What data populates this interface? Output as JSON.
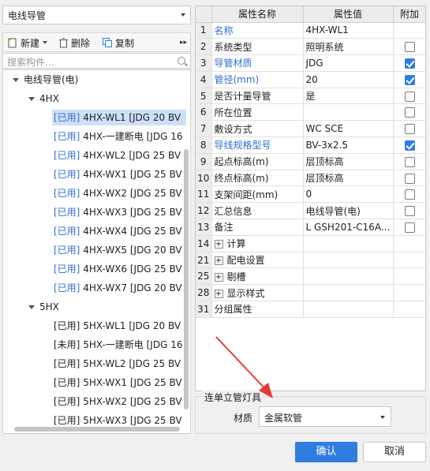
{
  "left_panel": {
    "category_select": "电线导管",
    "toolbar": {
      "new_label": "新建",
      "delete_label": "删除",
      "copy_label": "复制"
    },
    "search_placeholder": "搜索构件...",
    "tree": {
      "root": "电线导管(电)",
      "groups": [
        {
          "name": "4HX",
          "items": [
            {
              "tag": "[已用]",
              "text": " 4HX-WL1 [JDG 20 BV",
              "selected": true
            },
            {
              "tag": "[已用]",
              "text": " 4HX-一建断电 [JDG 16"
            },
            {
              "tag": "[已用]",
              "text": " 4HX-WL2 [JDG 25 BV"
            },
            {
              "tag": "[已用]",
              "text": " 4HX-WX1 [JDG 25 BV"
            },
            {
              "tag": "[已用]",
              "text": " 4HX-WX2 [JDG 25 BV"
            },
            {
              "tag": "[已用]",
              "text": " 4HX-WX3 [JDG 25 BV"
            },
            {
              "tag": "[已用]",
              "text": " 4HX-WX4 [JDG 25 BV"
            },
            {
              "tag": "[已用]",
              "text": " 4HX-WX5 [JDG 20 BV"
            },
            {
              "tag": "[已用]",
              "text": " 4HX-WX6 [JDG 25 BV"
            },
            {
              "tag": "[已用]",
              "text": " 4HX-WX7 [JDG 20 BV"
            }
          ]
        },
        {
          "name": "5HX",
          "items": [
            {
              "tag": "[已用]",
              "text": " 5HX-WL1 [JDG 20 BV"
            },
            {
              "tag": "[未用]",
              "text": " 5HX-一建断电 [JDG 16"
            },
            {
              "tag": "[已用]",
              "text": " 5HX-WL2 [JDG 25 BV"
            },
            {
              "tag": "[已用]",
              "text": " 5HX-WX1 [JDG 25 BV"
            },
            {
              "tag": "[已用]",
              "text": " 5HX-WX2 [JDG 25 BV"
            },
            {
              "tag": "[已用]",
              "text": " 5HX-WX3 [JDG 25 BV"
            }
          ]
        }
      ]
    }
  },
  "properties": {
    "headers": {
      "name": "属性名称",
      "value": "属性值",
      "extra": "附加"
    },
    "rows": [
      {
        "num": "1",
        "name": "名称",
        "value": "4HX-WL1",
        "blue": true
      },
      {
        "num": "2",
        "name": "系统类型",
        "value": "照明系统",
        "check": false
      },
      {
        "num": "3",
        "name": "导管材质",
        "value": "JDG",
        "blue": true,
        "check": true
      },
      {
        "num": "4",
        "name": "管径(mm)",
        "value": "20",
        "blue": true,
        "check": true
      },
      {
        "num": "5",
        "name": "是否计量导管",
        "value": "是",
        "check": false
      },
      {
        "num": "6",
        "name": "所在位置",
        "value": "",
        "check": false
      },
      {
        "num": "7",
        "name": "敷设方式",
        "value": "WC SCE",
        "check": false
      },
      {
        "num": "8",
        "name": "导线规格型号",
        "value": "BV-3x2.5",
        "blue": true,
        "check": true
      },
      {
        "num": "9",
        "name": "起点标高(m)",
        "value": "层顶标高",
        "check": false
      },
      {
        "num": "10",
        "name": "终点标高(m)",
        "value": "层顶标高",
        "check": false
      },
      {
        "num": "11",
        "name": "支架间距(mm)",
        "value": "0",
        "check": false
      },
      {
        "num": "12",
        "name": "汇总信息",
        "value": "电线导管(电)",
        "check": false
      },
      {
        "num": "13",
        "name": "备注",
        "value": "L GSH201-C16A...",
        "check": false
      },
      {
        "num": "14",
        "name": "计算",
        "value": "",
        "group": true
      },
      {
        "num": "21",
        "name": "配电设置",
        "value": "",
        "group": true
      },
      {
        "num": "25",
        "name": "剔槽",
        "value": "",
        "group": true
      },
      {
        "num": "28",
        "name": "显示样式",
        "value": "",
        "group": true
      },
      {
        "num": "31",
        "name": "分组属性",
        "value": ""
      }
    ]
  },
  "bottom_group": {
    "legend": "连单立管灯具",
    "material_label": "材质",
    "material_value": "金属软管"
  },
  "buttons": {
    "ok": "确认",
    "cancel": "取消"
  },
  "colors": {
    "accent": "#2f7de1",
    "link_blue": "#2f6fd1",
    "annotation_red": "#e53935"
  }
}
